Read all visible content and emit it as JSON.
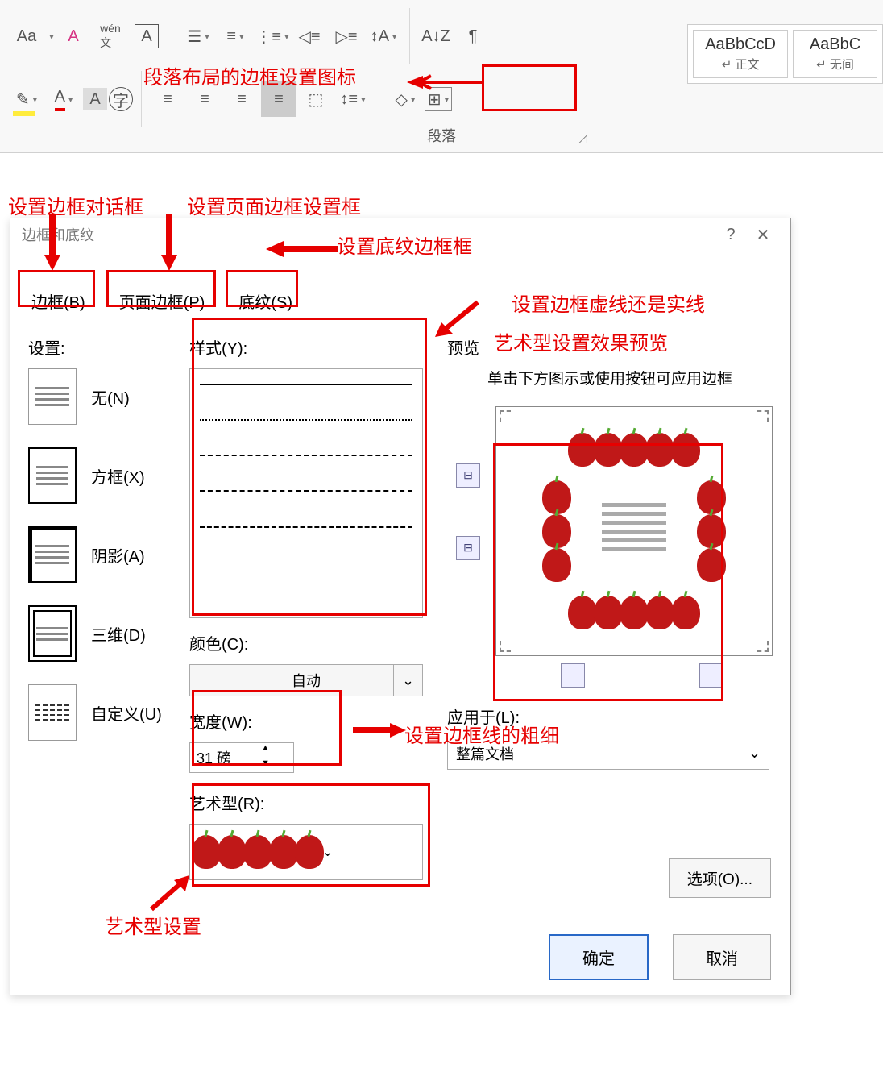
{
  "ribbon": {
    "group_label": "段落",
    "annotation_border_icon": "段落布局的边框设置图标",
    "styles": [
      {
        "name": "AaBbCcD",
        "sub": "↵ 正文"
      },
      {
        "name": "AaBbC",
        "sub": "↵ 无间"
      }
    ]
  },
  "annotations": {
    "dialog_box": "设置边框对话框",
    "page_border": "设置页面边框设置框",
    "shading": "设置底纹边框框",
    "line_style": "设置边框虚线还是实线",
    "art_preview": "艺术型设置效果预览",
    "width": "设置边框线的粗细",
    "art": "艺术型设置"
  },
  "dialog": {
    "title": "边框和底纹",
    "tabs": {
      "border": "边框(B)",
      "page": "页面边框(P)",
      "shading": "底纹(S)"
    },
    "setting_label": "设置:",
    "settings": {
      "none": "无(N)",
      "box": "方框(X)",
      "shadow": "阴影(A)",
      "threed": "三维(D)",
      "custom": "自定义(U)"
    },
    "style_label": "样式(Y):",
    "color_label": "颜色(C):",
    "color_value": "自动",
    "width_label": "宽度(W):",
    "width_value": "31 磅",
    "art_label": "艺术型(R):",
    "preview_label": "预览",
    "preview_hint": "单击下方图示或使用按钮可应用边框",
    "apply_label": "应用于(L):",
    "apply_value": "整篇文档",
    "options_btn": "选项(O)...",
    "ok": "确定",
    "cancel": "取消"
  }
}
